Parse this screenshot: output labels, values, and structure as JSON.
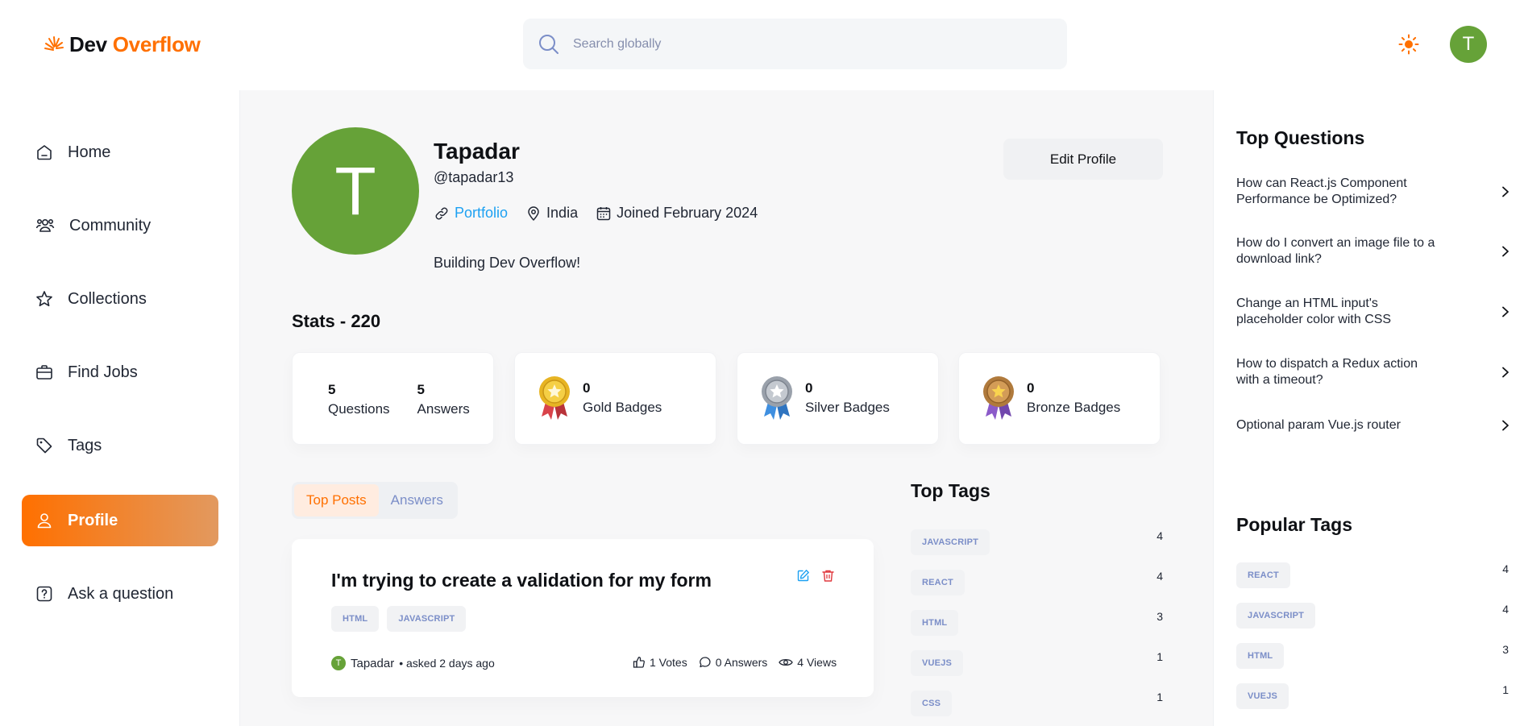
{
  "app": {
    "logo_dev": "Dev",
    "logo_overflow": "Overflow"
  },
  "search": {
    "placeholder": "Search globally"
  },
  "user_avatar_initial": "T",
  "sidebar": {
    "items": [
      {
        "label": "Home",
        "icon": "home-icon"
      },
      {
        "label": "Community",
        "icon": "users-icon"
      },
      {
        "label": "Collections",
        "icon": "star-icon"
      },
      {
        "label": "Find Jobs",
        "icon": "briefcase-icon"
      },
      {
        "label": "Tags",
        "icon": "tag-icon"
      },
      {
        "label": "Profile",
        "icon": "user-icon",
        "active": true
      },
      {
        "label": "Ask a question",
        "icon": "question-icon"
      }
    ]
  },
  "profile": {
    "initial": "T",
    "name": "Tapadar",
    "handle": "@tapadar13",
    "portfolio_label": "Portfolio",
    "location": "India",
    "joined": "Joined February 2024",
    "bio": "Building Dev Overflow!",
    "edit_label": "Edit Profile"
  },
  "stats": {
    "title": "Stats - 220",
    "questions_count": "5",
    "questions_label": "Questions",
    "answers_count": "5",
    "answers_label": "Answers",
    "gold_count": "0",
    "gold_label": "Gold Badges",
    "silver_count": "0",
    "silver_label": "Silver Badges",
    "bronze_count": "0",
    "bronze_label": "Bronze Badges"
  },
  "tabs": {
    "top_posts": "Top Posts",
    "answers": "Answers"
  },
  "post": {
    "title": "I'm trying to create a validation for my form",
    "tags": [
      "HTML",
      "JAVASCRIPT"
    ],
    "author_initial": "T",
    "author": "Tapadar",
    "asked": "• asked 2 days ago",
    "votes": "1 Votes",
    "answers": "0 Answers",
    "views": "4 Views"
  },
  "top_tags": {
    "title": "Top Tags",
    "items": [
      {
        "name": "JAVASCRIPT",
        "count": "4"
      },
      {
        "name": "REACT",
        "count": "4"
      },
      {
        "name": "HTML",
        "count": "3"
      },
      {
        "name": "VUEJS",
        "count": "1"
      },
      {
        "name": "CSS",
        "count": "1"
      }
    ]
  },
  "right": {
    "top_questions_title": "Top Questions",
    "top_questions": [
      "How can React.js Component Performance be Optimized?",
      "How do I convert an image file to a download link?",
      "Change an HTML input's placeholder color with CSS",
      "How to dispatch a Redux action with a timeout?",
      "Optional param Vue.js router"
    ],
    "popular_tags_title": "Popular Tags",
    "popular_tags": [
      {
        "name": "REACT",
        "count": "4"
      },
      {
        "name": "JAVASCRIPT",
        "count": "4"
      },
      {
        "name": "HTML",
        "count": "3"
      },
      {
        "name": "VUEJS",
        "count": "1"
      }
    ]
  },
  "colors": {
    "accent": "#ff7000",
    "avatar_green": "#66a238",
    "link_blue": "#1da1f2",
    "tag_text": "#7b8ec8"
  }
}
